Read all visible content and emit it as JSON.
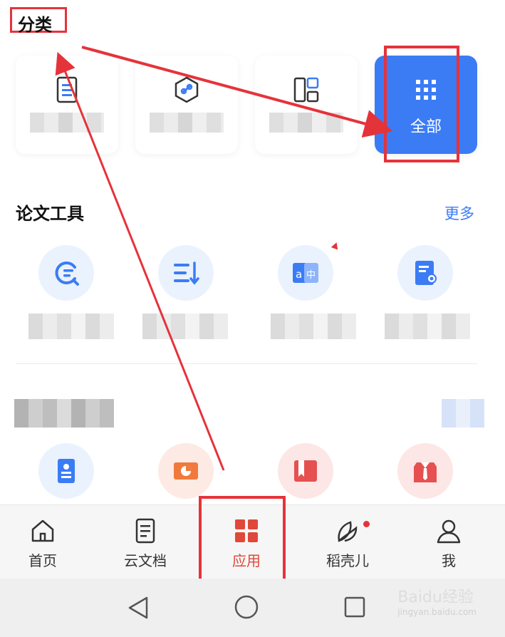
{
  "header": {
    "title": "分类"
  },
  "categories": {
    "all_label": "全部"
  },
  "paper_tools": {
    "title": "论文工具",
    "more_label": "更多"
  },
  "nav": {
    "items": [
      {
        "label": "首页",
        "icon": "home-icon"
      },
      {
        "label": "云文档",
        "icon": "document-icon"
      },
      {
        "label": "应用",
        "icon": "apps-grid-icon"
      },
      {
        "label": "稻壳儿",
        "icon": "leaf-icon"
      },
      {
        "label": "我",
        "icon": "person-icon"
      }
    ]
  },
  "watermark": {
    "text": "Baidu经验",
    "sub": "jingyan.baidu.com"
  },
  "colors": {
    "accent": "#3b7cf5",
    "active_nav": "#e0483a",
    "annotation": "#e5333a"
  }
}
